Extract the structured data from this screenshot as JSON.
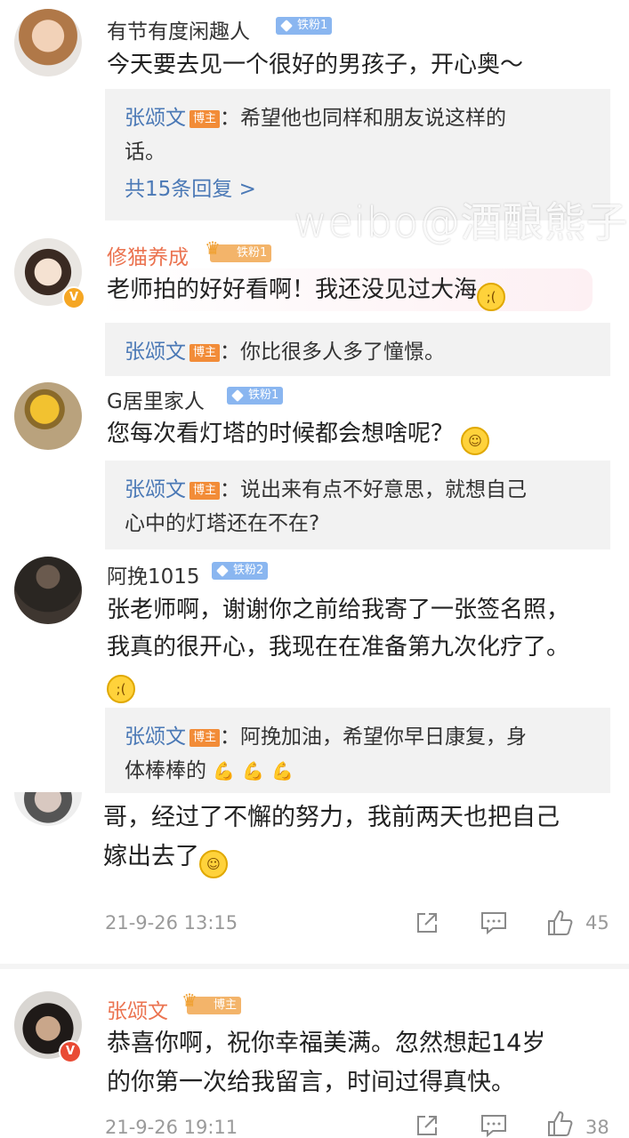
{
  "watermark": "weibo@酒酿熊子",
  "comments": [
    {
      "user": "有节有度闲趣人",
      "fan_badge": "铁粉1",
      "text": "今天要去见一个很好的男孩子，开心奥～",
      "reply": {
        "name": "张颂文",
        "tag": "博主",
        "line1": "：希望他也同样和朋友说这样的",
        "line2": "话。",
        "more": "共15条回复 >"
      }
    },
    {
      "user": "修猫养成",
      "fan_badge": "铁粉1",
      "text": "老师拍的好好看啊！我还没见过大海",
      "emoji": "crying-face",
      "reply": {
        "name": "张颂文",
        "tag": "博主",
        "line1": "：你比很多人多了憧憬。"
      }
    },
    {
      "user": "G居里家人",
      "fan_badge": "铁粉1",
      "text": "您每次看灯塔的时候都会想啥呢？",
      "emoji": "grin-face",
      "reply": {
        "name": "张颂文",
        "tag": "博主",
        "line1": "：说出来有点不好意思，就想自己",
        "line2": "心中的灯塔还在不在?"
      }
    },
    {
      "user": "阿挽1015",
      "fan_badge": "铁粉2",
      "text_line1": "张老师啊，谢谢你之前给我寄了一张签名照，",
      "text_line2": "我真的很开心，我现在在准备第九次化疗了。",
      "emoji": "crying-face",
      "reply": {
        "name": "张颂文",
        "tag": "博主",
        "line1": "：阿挽加油，希望你早日康复，身",
        "line2": "体棒棒的"
      }
    },
    {
      "text_line1": "哥，经过了不懈的努力，我前两天也把自己",
      "text_line2": "嫁出去了",
      "emoji": "grin-face",
      "time": "21-9-26 13:15",
      "likes": "45"
    }
  ],
  "post": {
    "user": "张颂文",
    "tag": "博主",
    "text_line1": "恭喜你啊，祝你幸福美满。忽然想起14岁",
    "text_line2": "的你第一次给我留言，时间过得真快。",
    "time": "21-9-26 19:11",
    "likes": "38"
  },
  "colors": {
    "link": "#4b79b6",
    "host_tag": "#f28c38",
    "fan_badge": "#8ab6f0",
    "orange_name": "#eb7350"
  }
}
